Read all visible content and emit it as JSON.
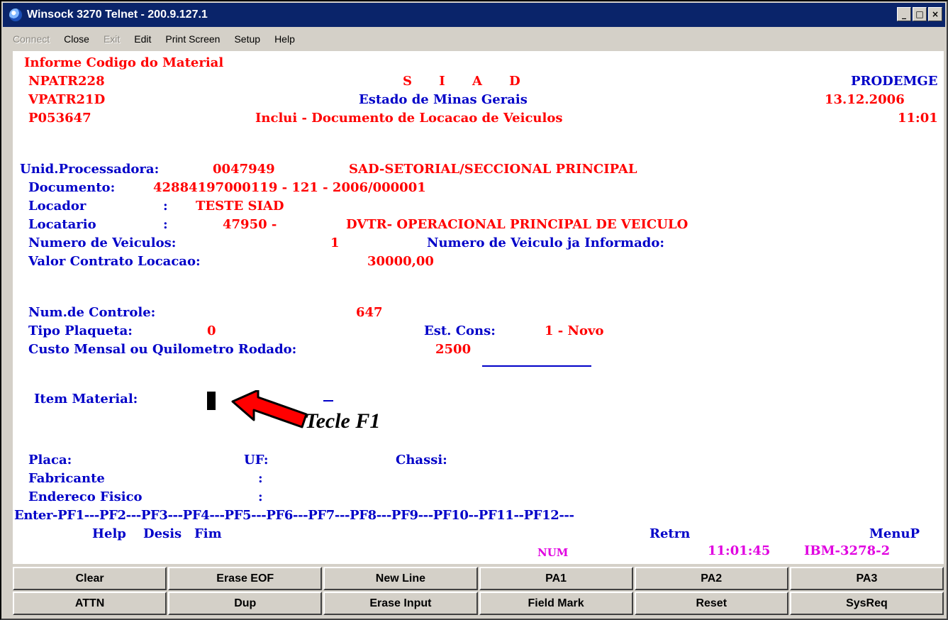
{
  "window": {
    "title": "Winsock 3270 Telnet - 200.9.127.1",
    "controls": {
      "minimize": "_",
      "maximize": "□",
      "close": "×"
    }
  },
  "menu": {
    "items": [
      {
        "label": "Connect",
        "enabled": false
      },
      {
        "label": "Close",
        "enabled": true
      },
      {
        "label": "Exit",
        "enabled": false
      },
      {
        "label": "Edit",
        "enabled": true
      },
      {
        "label": "Print Screen",
        "enabled": true
      },
      {
        "label": "Setup",
        "enabled": true
      },
      {
        "label": "Help",
        "enabled": true
      }
    ]
  },
  "screen": {
    "message": "Informe Codigo do Material",
    "program": "NPATR228",
    "system_name": "S I A D",
    "company": "PRODEMGE",
    "screen_id": "VPATR21D",
    "state": "Estado de Minas Gerais",
    "date": "13.12.2006",
    "user_id": "P053647",
    "function_title": "Inclui - Documento de Locacao de Veiculos",
    "time": "11:01",
    "unid_label": "Unid.Processadora:",
    "unid_code": "0047949",
    "unid_name": "SAD-SETORIAL/SECCIONAL PRINCIPAL",
    "documento_label": "Documento:",
    "documento_value": "42884197000119 - 121 - 2006/000001",
    "locador_label": "Locador",
    "locador_sep": ":",
    "locador_value": "TESTE SIAD",
    "locatario_label": "Locatario",
    "locatario_sep": ":",
    "locatario_code": "47950 -",
    "locatario_name": "DVTR- OPERACIONAL PRINCIPAL DE VEICULO",
    "num_veiculos_label": "Numero de Veiculos:",
    "num_veiculos_value": "1",
    "num_informado_label": "Numero de Veiculo ja Informado:",
    "valor_label": "Valor Contrato Locacao:",
    "valor_value": "30000,00",
    "num_controle_label": "Num.de Controle:",
    "num_controle_value": "647",
    "tipo_plaqueta_label": "Tipo Plaqueta:",
    "tipo_plaqueta_value": "0",
    "est_cons_label": "Est. Cons:",
    "est_cons_value": "1 - Novo",
    "custo_label": "Custo Mensal ou Quilometro Rodado:",
    "custo_value": "2500",
    "item_material_label": "Item Material:",
    "item_material_dash": "-",
    "placa_label": "Placa:",
    "uf_label": "UF:",
    "chassi_label": "Chassi:",
    "fabricante_label": "Fabricante",
    "fabricante_sep": ":",
    "endereco_label": "Endereco Fisico",
    "endereco_sep": ":",
    "pf_line": "Enter-PF1---PF2---PF3---PF4---PF5---PF6---PF7---PF8---PF9---PF10--PF11--PF12---",
    "pf_help": "Help",
    "pf_desis": "Desis",
    "pf_fim": "Fim",
    "pf_retrn": "Retrn",
    "pf_menup": "MenuP",
    "status_num": "NUM",
    "status_time": "11:01:45",
    "status_terminal": "IBM-3278-2"
  },
  "annotation": {
    "text": "Tecle F1",
    "arrow_color": "#ff0000"
  },
  "keypad": {
    "row1": [
      "Clear",
      "Erase EOF",
      "New Line",
      "PA1",
      "PA2",
      "PA3"
    ],
    "row2": [
      "ATTN",
      "Dup",
      "Erase Input",
      "Field Mark",
      "Reset",
      "SysReq"
    ]
  },
  "colors": {
    "titlebar": "#0a246a",
    "field_protected": "#0000c8",
    "field_data": "#ff0000",
    "status": "#e000e0"
  }
}
